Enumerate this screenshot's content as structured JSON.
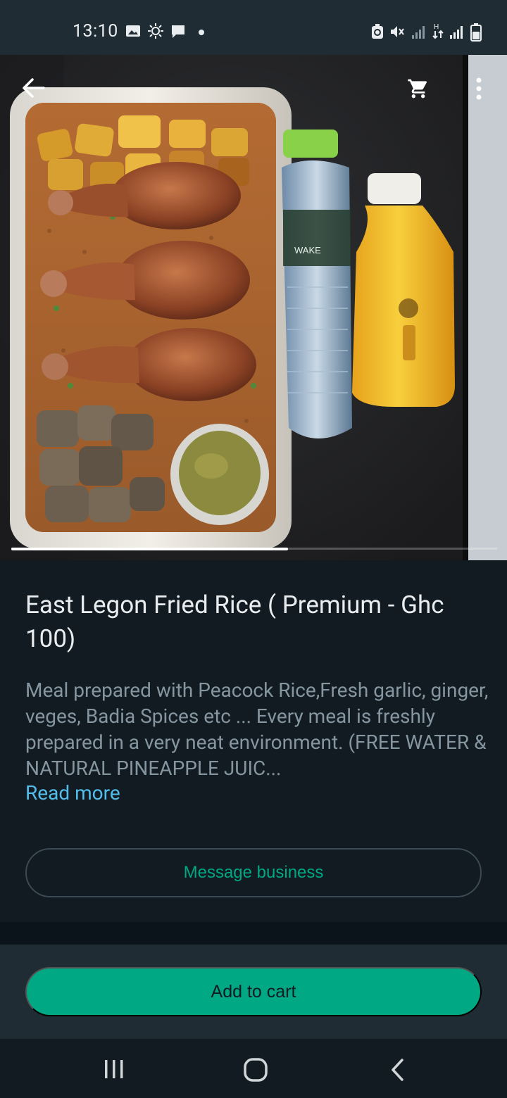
{
  "status_bar": {
    "time": "13:10",
    "icons": [
      "gallery-icon",
      "brightness-icon",
      "chat-notification-icon",
      "dot-icon",
      "recycle-icon",
      "mute-icon",
      "signal-icon",
      "data-transfer-icon",
      "signal-icon",
      "battery-icon"
    ]
  },
  "header": {
    "back_icon": "arrow-left-icon",
    "cart_icon": "cart-icon",
    "menu_icon": "more-vert-icon"
  },
  "carousel": {
    "current_index": 1,
    "progress_fraction": 0.57
  },
  "product": {
    "title": "East Legon Fried Rice ( Premium - Ghc 100)",
    "description": "Meal prepared with Peacock Rice,Fresh garlic, ginger,  veges, Badia Spices etc ... Every meal is freshly prepared in a very neat environment. (FREE WATER & NATURAL PINEAPPLE JUIC...",
    "read_more_label": "Read more"
  },
  "actions": {
    "message_business_label": "Message business",
    "add_to_cart_label": "Add to cart"
  },
  "colors": {
    "accent": "#00a884",
    "link": "#53bdeb",
    "background": "#111b21",
    "panel": "#1f2c34",
    "secondary_text": "#8696a0"
  },
  "nav": {
    "icons": [
      "recents-icon",
      "home-icon",
      "back-icon"
    ]
  }
}
